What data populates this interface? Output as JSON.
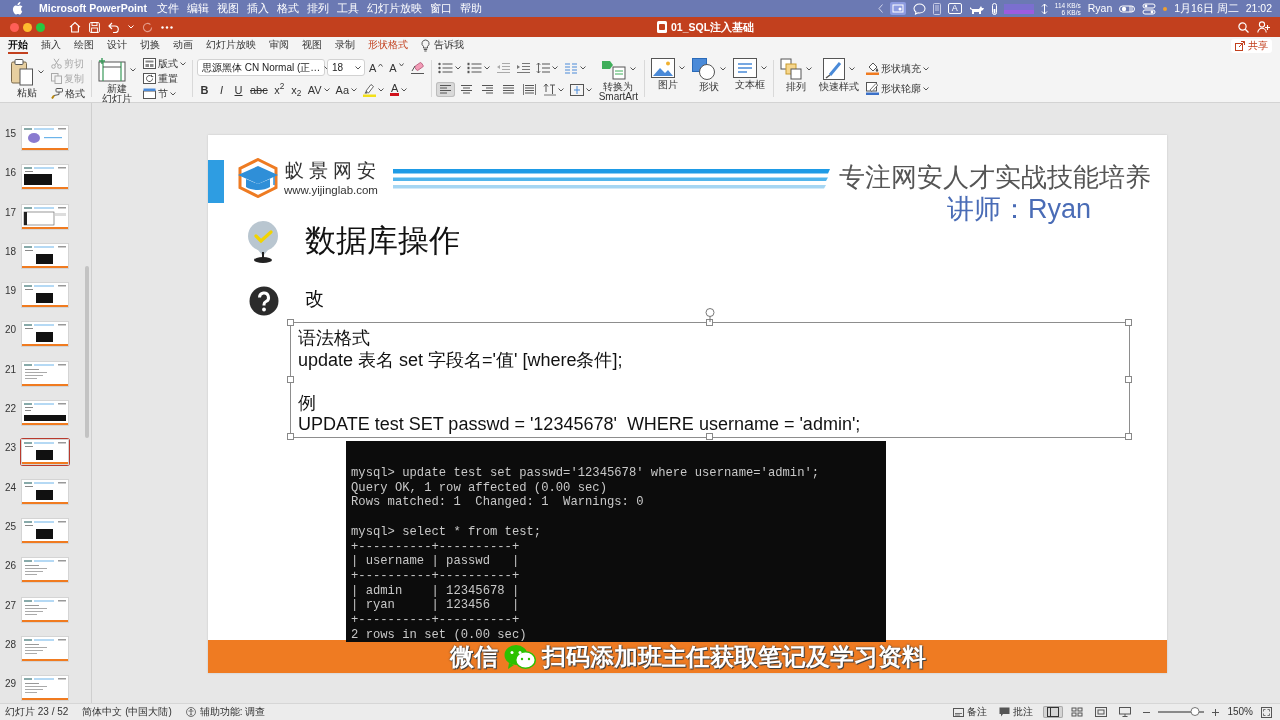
{
  "menu_bar": {
    "app_name": "Microsoft PowerPoint",
    "menus": [
      "文件",
      "编辑",
      "视图",
      "插入",
      "格式",
      "排列",
      "工具",
      "幻灯片放映",
      "窗口",
      "帮助"
    ],
    "input_source": "A",
    "network_upload": "114 KB/s",
    "network_download": "6 KB/s",
    "user": "Ryan",
    "date": "1月16日 周二",
    "time": "21:02"
  },
  "title_bar": {
    "document_title": "01_SQL注入基础"
  },
  "ribbon": {
    "tabs": [
      {
        "label": "开始",
        "kind": "tab",
        "selected": true
      },
      {
        "label": "插入",
        "kind": "tab",
        "selected": false
      },
      {
        "label": "绘图",
        "kind": "tab",
        "selected": false
      },
      {
        "label": "设计",
        "kind": "tab",
        "selected": false
      },
      {
        "label": "切换",
        "kind": "tab",
        "selected": false
      },
      {
        "label": "动画",
        "kind": "tab",
        "selected": false
      },
      {
        "label": "幻灯片放映",
        "kind": "tab",
        "selected": false
      },
      {
        "label": "审阅",
        "kind": "tab",
        "selected": false
      },
      {
        "label": "视图",
        "kind": "tab",
        "selected": false
      },
      {
        "label": "录制",
        "kind": "tab",
        "selected": false
      },
      {
        "label": "形状格式",
        "kind": "contextual",
        "selected": false
      },
      {
        "label": "告诉我",
        "kind": "search",
        "selected": false
      }
    ],
    "share_button": "共享",
    "clipboard": {
      "paste": "粘贴",
      "items": [
        {
          "label": "剪切",
          "kind": "cut",
          "disabled": true
        },
        {
          "label": "复制",
          "kind": "copy",
          "disabled": true
        },
        {
          "label": "格式",
          "kind": "painter",
          "disabled": false
        }
      ]
    },
    "slides": {
      "new_slide": [
        "新建",
        "幻灯片"
      ],
      "items": [
        {
          "label": "版式",
          "kind": "layout",
          "dropdown": true
        },
        {
          "label": "重置",
          "kind": "reset",
          "dropdown": false
        },
        {
          "label": "节",
          "kind": "section",
          "dropdown": true
        }
      ]
    },
    "font": {
      "name": "思源黑体 CN Normal (正…",
      "size": "18",
      "size_buttons": [
        {
          "label": "A",
          "kind": "grow"
        },
        {
          "label": "A",
          "kind": "shrink"
        }
      ],
      "styles": [
        {
          "label": "B",
          "kind": "bold"
        },
        {
          "label": "I",
          "kind": "italic"
        },
        {
          "label": "U",
          "kind": "underline"
        },
        {
          "label": "abc",
          "kind": "strike"
        },
        {
          "label": "x$^{2}$",
          "kind": "superscript"
        },
        {
          "label": "x$_{2}$",
          "kind": "subscript"
        },
        {
          "label": "AV",
          "kind": "spacing"
        },
        {
          "label": "Aa",
          "kind": "case"
        }
      ],
      "font_color": "A"
    },
    "paragraph": {
      "alignment": [
        {
          "kind": "left",
          "selected": true
        },
        {
          "kind": "center",
          "selected": false
        },
        {
          "kind": "right",
          "selected": false
        },
        {
          "kind": "justify",
          "selected": false
        },
        {
          "kind": "distributed",
          "selected": false
        }
      ],
      "smartart": [
        "转换为",
        "SmartArt"
      ]
    },
    "insert": [
      {
        "label": "图片",
        "kind": "picture"
      },
      {
        "label": "形状",
        "kind": "shapes"
      },
      {
        "label": "文本框",
        "kind": "textbox"
      }
    ],
    "drawing": {
      "arrange": "排列",
      "quick_styles": "快速样式",
      "shape_fill": "形状填充",
      "shape_outline": "形状轮廓"
    }
  },
  "thumbnails": {
    "items": [
      {
        "number": "15",
        "kind": "diagram",
        "selected": false
      },
      {
        "number": "16",
        "kind": "large_terminal",
        "selected": false
      },
      {
        "number": "17",
        "kind": "screenshot",
        "selected": false
      },
      {
        "number": "18",
        "kind": "terminal",
        "selected": false
      },
      {
        "number": "19",
        "kind": "terminal",
        "selected": false
      },
      {
        "number": "20",
        "kind": "terminal",
        "selected": false
      },
      {
        "number": "21",
        "kind": "text",
        "selected": false
      },
      {
        "number": "22",
        "kind": "wide_terminal",
        "selected": false
      },
      {
        "number": "23",
        "kind": "terminal",
        "selected": true
      },
      {
        "number": "24",
        "kind": "terminal",
        "selected": false
      },
      {
        "number": "25",
        "kind": "terminal",
        "selected": false
      },
      {
        "number": "26",
        "kind": "text",
        "selected": false
      },
      {
        "number": "27",
        "kind": "text",
        "selected": false
      },
      {
        "number": "28",
        "kind": "text",
        "selected": false
      },
      {
        "number": "29",
        "kind": "text",
        "selected": false
      }
    ]
  },
  "slide": {
    "brand_name": "蚁景网安",
    "brand_url": "www.yijinglab.com",
    "slogan": "专注网安人才实战技能培养",
    "lecturer": "讲师：Ryan",
    "title": "数据库操作",
    "subtitle": "改",
    "text_box": {
      "paragraphs": [
        [
          "语法格式",
          "update 表名 set 字段名='值' [where条件];"
        ],
        [
          "例",
          "UPDATE test SET passwd = '12345678'  WHERE username = 'admin';"
        ]
      ]
    },
    "terminal": {
      "blocks": [
        [
          "mysql> update test set passwd='12345678' where username='admin';",
          "Query OK, 1 row affected (0.00 sec)",
          "Rows matched: 1  Changed: 1  Warnings: 0"
        ],
        [
          "mysql> select * from test;",
          "+----------+----------+",
          "| username | passwd   |",
          "+----------+----------+",
          "| admin    | 12345678 |",
          "| ryan     | 123456   |",
          "+----------+----------+",
          "2 rows in set (0.00 sec)"
        ]
      ]
    },
    "footer": {
      "label": "微信",
      "text": "扫码添加班主任获取笔记及学习资料"
    }
  },
  "status_bar": {
    "slide_counter": "幻灯片 23 / 52",
    "language": "简体中文 (中国大陆)",
    "accessibility": "辅助功能: 调查",
    "notes": "备注",
    "comments": "批注",
    "views": [
      {
        "kind": "normal",
        "selected": true
      },
      {
        "kind": "sorter",
        "selected": false
      },
      {
        "kind": "reading",
        "selected": false
      },
      {
        "kind": "slideshow",
        "selected": false
      }
    ],
    "zoom": {
      "level": 0.8,
      "reading": "150%"
    }
  }
}
